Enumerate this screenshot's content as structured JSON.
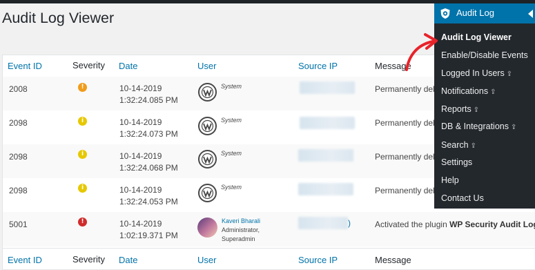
{
  "page": {
    "title": "Audit Log Viewer"
  },
  "table": {
    "headers": {
      "event_id": "Event ID",
      "severity": "Severity",
      "date": "Date",
      "user": "User",
      "source_ip": "Source IP",
      "message": "Message"
    },
    "rows": [
      {
        "event_id": "2008",
        "severity_color": "orange",
        "severity_glyph": "!",
        "date": "10-14-2019",
        "time": "1:32:24.085 PM",
        "user": "System",
        "message": "Permanently dele"
      },
      {
        "event_id": "2098",
        "severity_color": "yellow",
        "severity_glyph": "i",
        "date": "10-14-2019",
        "time": "1:32:24.073 PM",
        "user": "System",
        "message": "Permanently dele"
      },
      {
        "event_id": "2098",
        "severity_color": "yellow",
        "severity_glyph": "i",
        "date": "10-14-2019",
        "time": "1:32:24.068 PM",
        "user": "System",
        "message": "Permanently dele"
      },
      {
        "event_id": "2098",
        "severity_color": "yellow",
        "severity_glyph": "i",
        "date": "10-14-2019",
        "time": "1:32:24.053 PM",
        "user": "System",
        "message": "Permanently dele"
      },
      {
        "event_id": "5001",
        "severity_color": "red",
        "severity_glyph": "!",
        "date": "10-14-2019",
        "time": "1:02:19.371 PM",
        "user_name": "Kaveri Bharali",
        "user_role1": "Administrator,",
        "user_role2": "Superadmin",
        "message_prefix": "Activated the plugin ",
        "message_bold": "WP Security Audit Log"
      }
    ]
  },
  "menu": {
    "title": "Audit Log",
    "items": [
      {
        "label": "Audit Log Viewer",
        "active": true
      },
      {
        "label": "Enable/Disable Events"
      },
      {
        "label": "Logged In Users",
        "lock": "⇪"
      },
      {
        "label": "Notifications",
        "lock": "⇪"
      },
      {
        "label": "Reports",
        "lock": "⇪"
      },
      {
        "label": "DB & Integrations",
        "lock": "⇪"
      },
      {
        "label": "Search",
        "lock": "⇪"
      },
      {
        "label": "Settings"
      },
      {
        "label": "Help"
      },
      {
        "label": "Contact Us"
      }
    ]
  },
  "colors": {
    "accent": "#0073aa",
    "sidebar": "#23282d",
    "arrow": "#e8232a"
  },
  "icons": {
    "menu_icon": "shield-icon",
    "user_icon": "wordpress-logo-icon"
  }
}
